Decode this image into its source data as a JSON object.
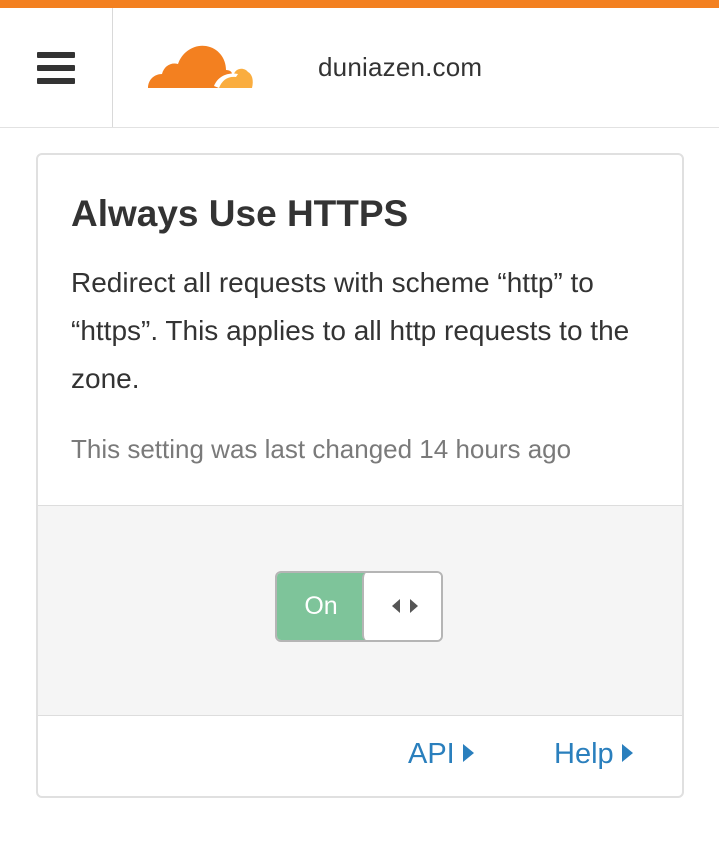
{
  "header": {
    "domain": "duniazen.com",
    "menu_icon": "hamburger-menu-icon",
    "logo": "cloudflare-logo"
  },
  "setting_card": {
    "title": "Always Use HTTPS",
    "description": "Redirect all requests with scheme “http” to “https”. This applies to all http requests to the zone.",
    "last_changed": "This setting was last changed 14 hours ago",
    "toggle": {
      "label": "On",
      "state": "on",
      "handle_icon": "left-right-arrows-icon"
    },
    "links": {
      "api": "API",
      "help": "Help"
    }
  },
  "colors": {
    "accent_orange": "#f38020",
    "toggle_green": "#7ec49a",
    "link_blue": "#2a7fbd"
  }
}
